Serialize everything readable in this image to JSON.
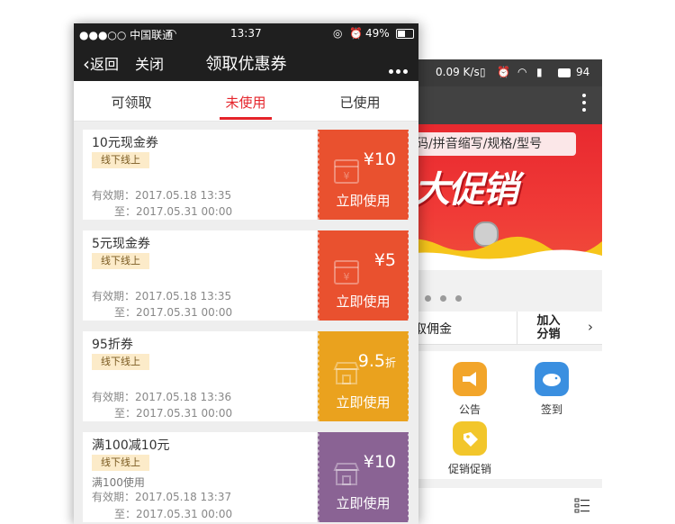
{
  "front": {
    "status": {
      "carrier": "●●●○○ 中国联通",
      "time": "13:37",
      "battery": "49%"
    },
    "nav": {
      "back_label": "返回",
      "close_label": "关闭",
      "title": "领取优惠券",
      "more_icon": "more-icon"
    },
    "tabs": [
      {
        "label": "可领取",
        "active": false
      },
      {
        "label": "未使用",
        "active": true
      },
      {
        "label": "已使用",
        "active": false
      }
    ],
    "accent_color": "#e5232a",
    "coupons": [
      {
        "name": "10元现金券",
        "badge": "线下线上",
        "note": "",
        "valid_from": "有效期：2017.05.18 13:35",
        "valid_to": "至：2017.05.31 00:00",
        "value_symbol": "¥",
        "value": "10",
        "value_suffix": "",
        "action": "立即使用",
        "color": "#e9512f",
        "icon": "cash-coupon-icon"
      },
      {
        "name": "5元现金券",
        "badge": "线下线上",
        "note": "",
        "valid_from": "有效期：2017.05.18 13:35",
        "valid_to": "至：2017.05.31 00:00",
        "value_symbol": "¥",
        "value": "5",
        "value_suffix": "",
        "action": "立即使用",
        "color": "#e9512f",
        "icon": "cash-coupon-icon"
      },
      {
        "name": "95折券",
        "badge": "线下线上",
        "note": "",
        "valid_from": "有效期：2017.05.18 13:36",
        "valid_to": "至：2017.05.31 00:00",
        "value_symbol": "",
        "value": "9.5",
        "value_suffix": "折",
        "action": "立即使用",
        "color": "#eaa21e",
        "icon": "store-icon"
      },
      {
        "name": "满100减10元",
        "badge": "线下线上",
        "note": "满100使用",
        "valid_from": "有效期：2017.05.18 13:37",
        "valid_to": "至：2017.05.31 00:00",
        "value_symbol": "¥",
        "value": "10",
        "value_suffix": "",
        "action": "立即使用",
        "color": "#8a6394",
        "icon": "store-icon"
      }
    ]
  },
  "back": {
    "status": {
      "speed": "0.09 K/s",
      "battery": "94"
    },
    "search_text": "码/拼音缩写/规格/型号",
    "promo_text": "大促销",
    "commission_label": "取佣金",
    "join_label_1": "加入",
    "join_label_2": "分销",
    "menu": [
      {
        "label": "公告",
        "icon": "megaphone-icon",
        "color": "#f2a52a"
      },
      {
        "label": "签到",
        "icon": "piggy-bank-icon",
        "color": "#3a8fe0"
      },
      {
        "label": "促销促销",
        "icon": "tag-icon",
        "color": "#f2c62b"
      }
    ]
  }
}
